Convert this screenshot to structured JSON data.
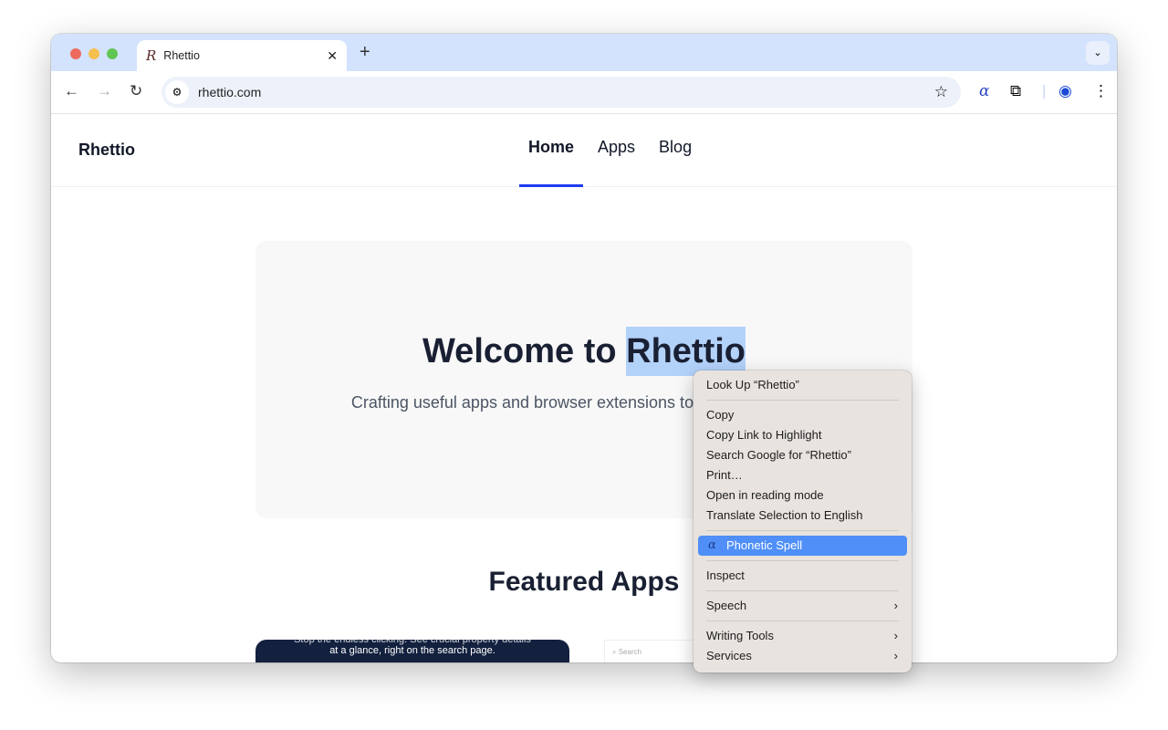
{
  "browser": {
    "tab_title": "Rhettio",
    "url": "rhettio.com"
  },
  "site": {
    "logo": "Rhettio",
    "nav": [
      "Home",
      "Apps",
      "Blog"
    ],
    "hero_title_prefix": "Welcome to ",
    "hero_title_selected": "Rhettio",
    "hero_subtitle": "Crafting useful apps and browser extensions to make life easier.",
    "featured_title": "Featured Apps",
    "card1_text_top": "Stop the endless clicking. See crucial property details",
    "card1_text": "at a glance, right on the search page.",
    "card2_search": "Search"
  },
  "context_menu": {
    "items": [
      "Look Up “Rhettio”",
      "Copy",
      "Copy Link to Highlight",
      "Search Google for “Rhettio”",
      "Print…",
      "Open in reading mode",
      "Translate Selection to English",
      "Phonetic Spell",
      "Inspect",
      "Speech",
      "Writing Tools",
      "Services"
    ]
  }
}
